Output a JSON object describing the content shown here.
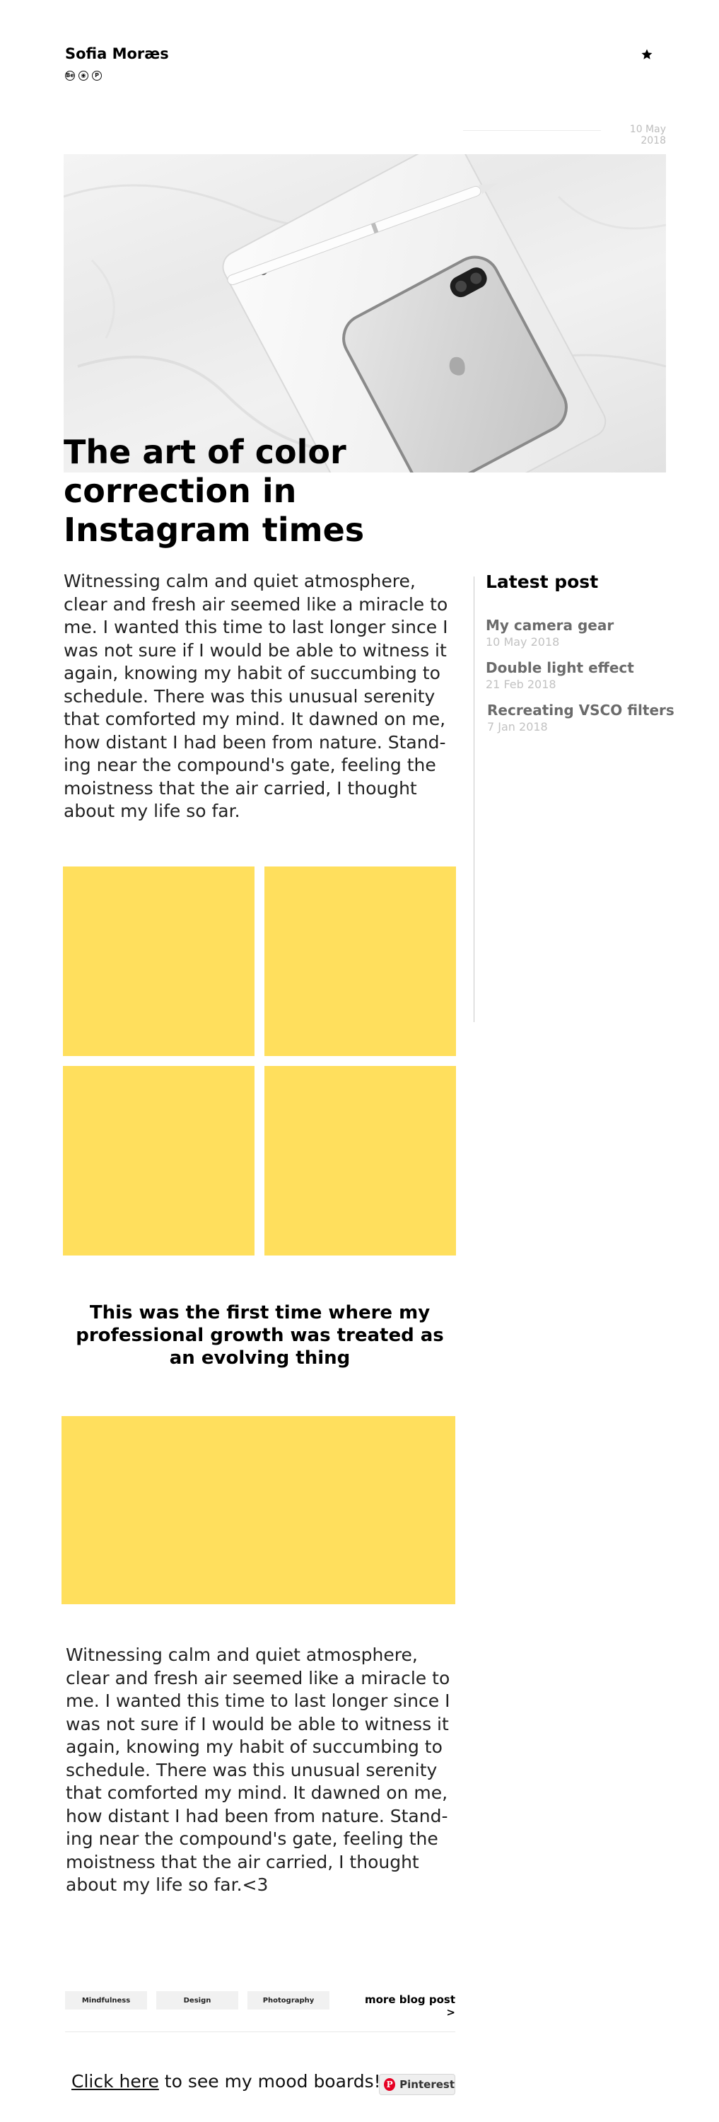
{
  "header": {
    "author": "Sofia Moræs",
    "social_icons": [
      {
        "name": "behance-icon",
        "glyph": "Be"
      },
      {
        "name": "dribbble-icon",
        "glyph": "◉"
      },
      {
        "name": "pinterest-icon",
        "glyph": "P"
      }
    ],
    "star_icon": "star-icon"
  },
  "post": {
    "date": "10 May 2018",
    "title": "The art of color correction in Instagram times",
    "body": "Witnessing calm and quiet atmosphere, clear and fresh air seemed like a miracle to me. I wanted this time to last longer since I was not sure if I would be able to witness it again, knowing my habit of succumbing to schedule. There was this unusual serenity that comforted my mind. It dawned on me, how distant I had been from nature. Stand-ing near the compound's gate, feeling the moistness that the air carried, I thought about my life so far.",
    "pull_quote": "This was the first time where my professional growth was treated as an evolving thing",
    "body_2": "Witnessing calm and quiet atmosphere, clear and fresh air seemed like a miracle to me. I wanted this time to last longer since I was not sure if I would be able to witness it again, knowing my habit of succumbing to schedule. There was this unusual serenity that comforted my mind. It dawned on me, how distant I had been from nature. Stand-ing near the compound's gate, feeling the moistness that the air carried, I thought about my life so far.<3"
  },
  "sidebar": {
    "title": "Latest post",
    "items": [
      {
        "title": "My camera gear",
        "date": "10 May 2018"
      },
      {
        "title": "Double light effect",
        "date": "21 Feb 2018"
      },
      {
        "title": "Recreating VSCO filters",
        "date": "7 Jan 2018"
      }
    ]
  },
  "footer": {
    "tags": [
      "Mindfulness",
      "Design",
      "Photography"
    ],
    "more_posts": "more blog post >",
    "mood_link": "Click here",
    "mood_text": " to see my mood boards!",
    "pinterest_label": "Pinterest"
  },
  "colors": {
    "accent_yellow": "#ffdf5d",
    "text": "#111111",
    "muted": "#6b6b6b",
    "light": "#c2c2c2",
    "pinterest_red": "#e60023"
  }
}
